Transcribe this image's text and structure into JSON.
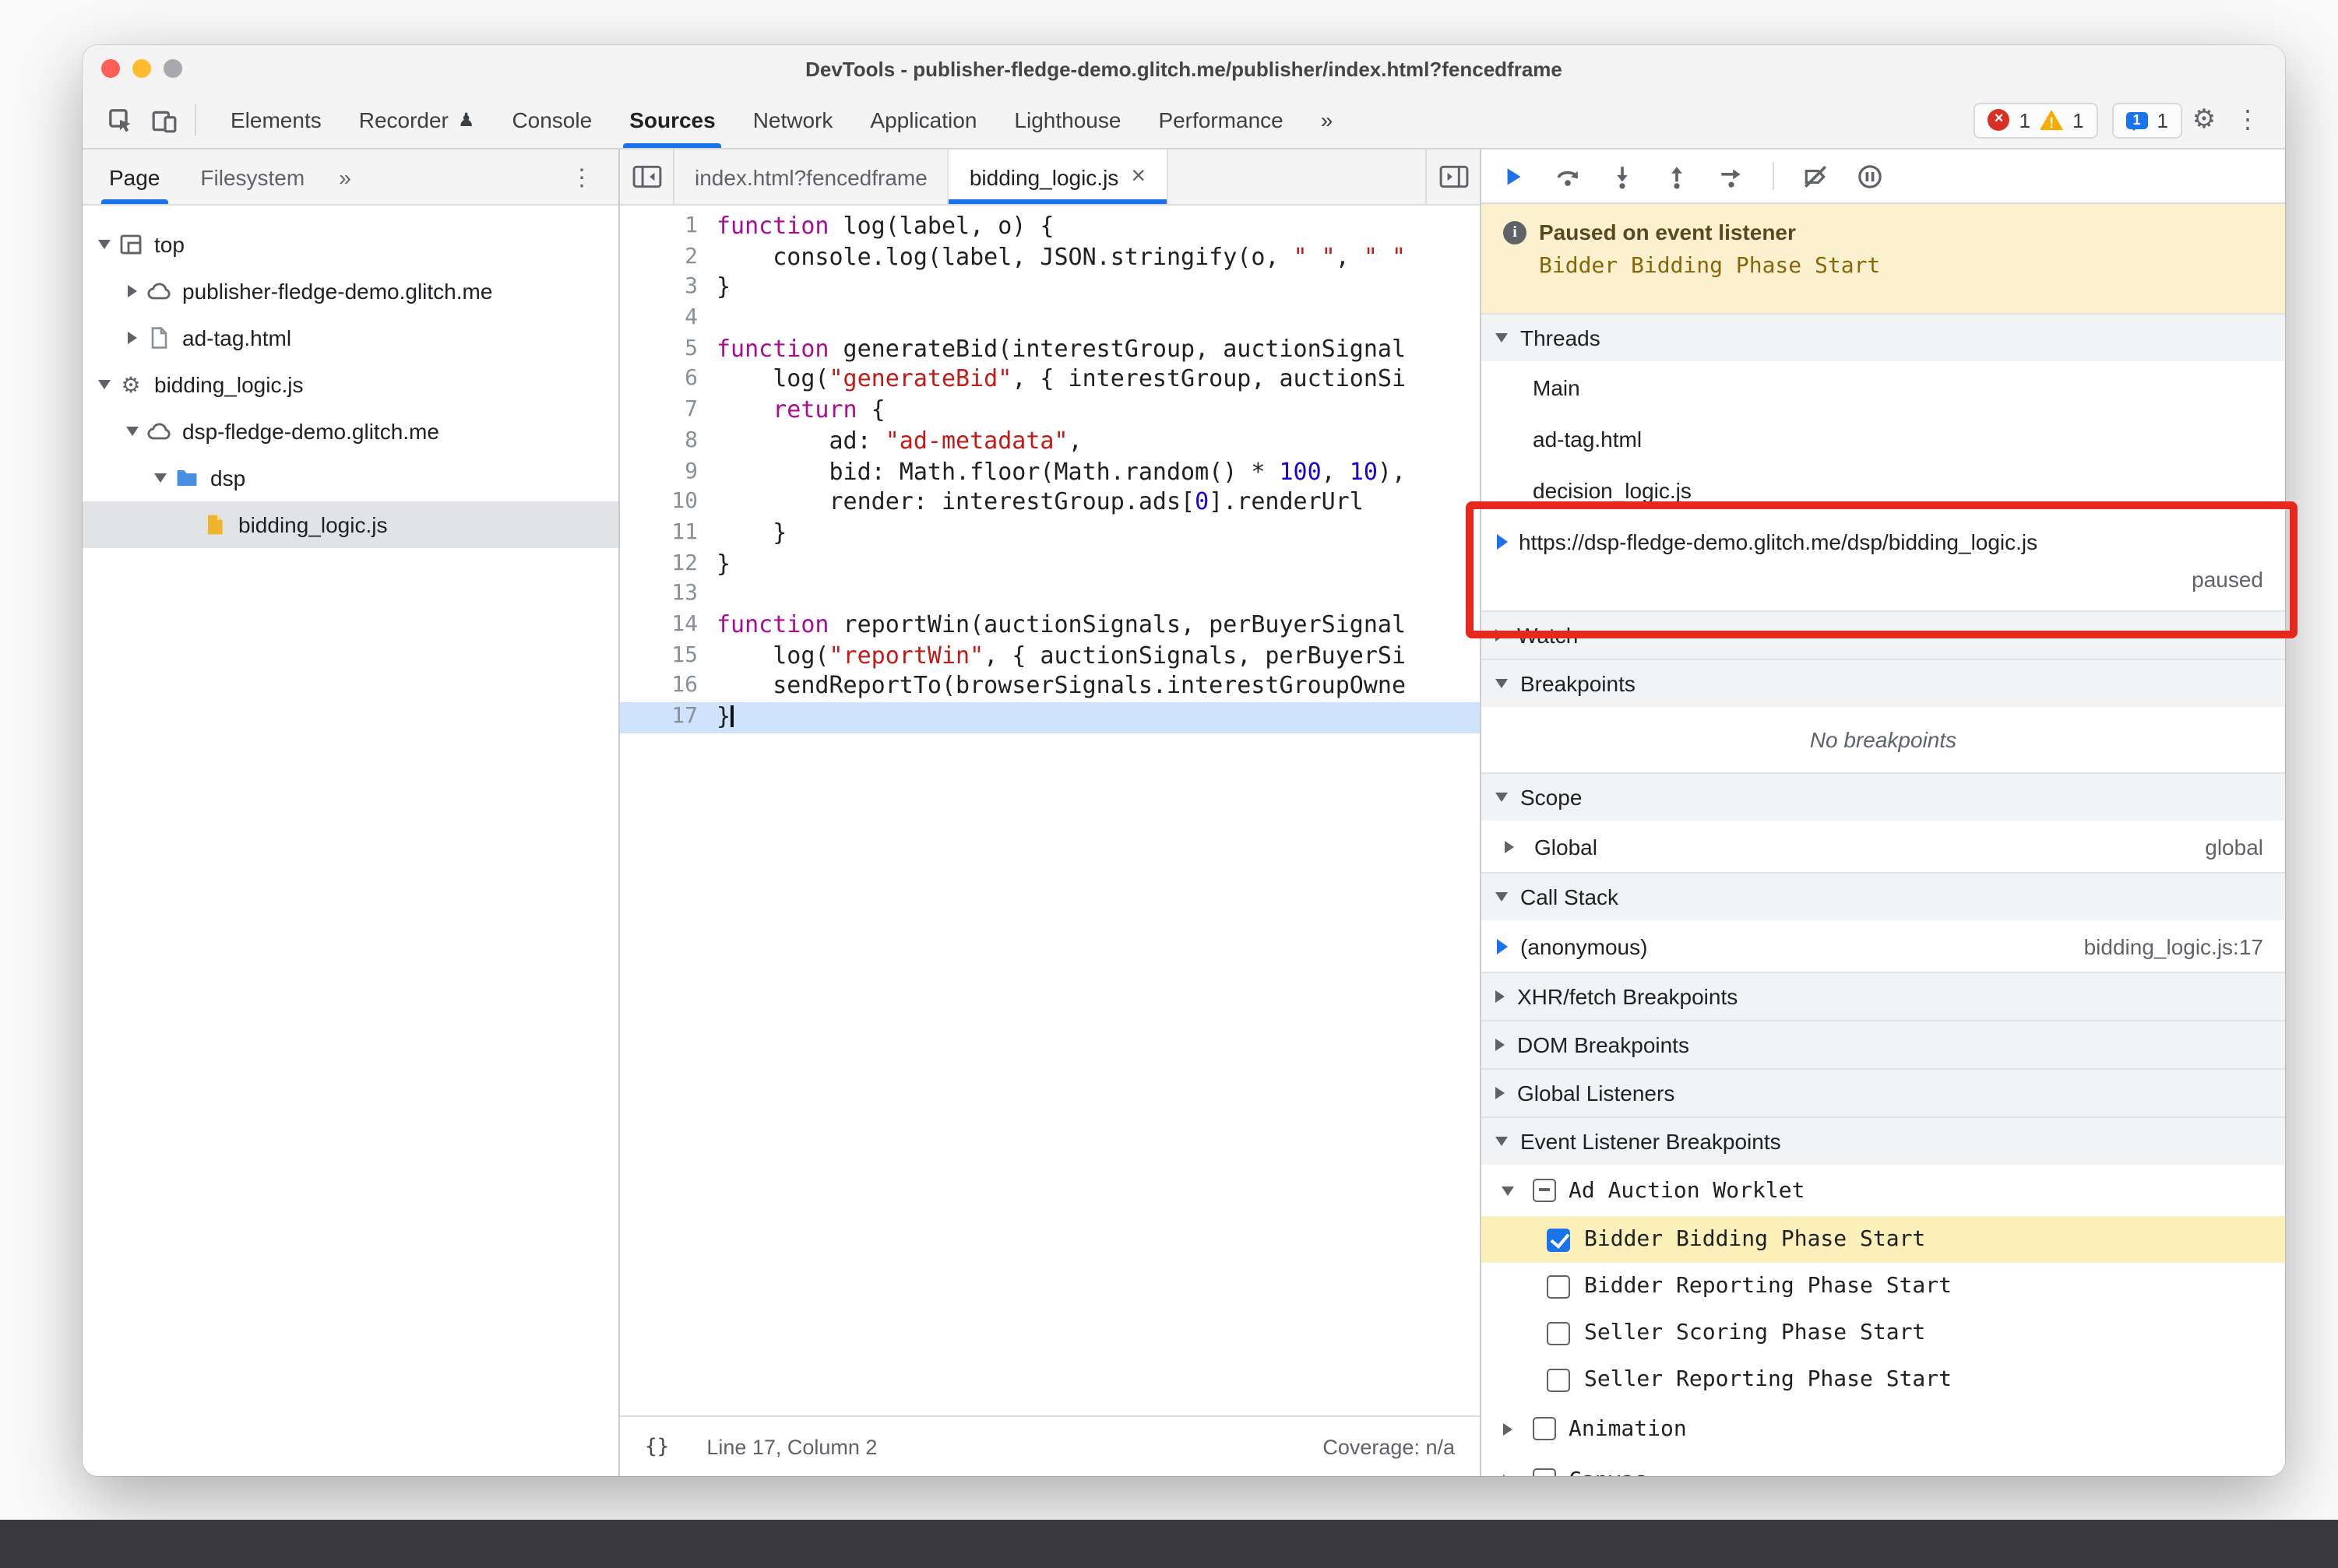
{
  "window": {
    "title": "DevTools - publisher-fledge-demo.glitch.me/publisher/index.html?fencedframe"
  },
  "colors": {
    "accent": "#1a73e8",
    "paused_banner": "#fbf1cf",
    "error": "#d93025",
    "warning": "#f9ab00",
    "annotation": "#e8271e"
  },
  "toolbar": {
    "tabs": [
      "Elements",
      "Recorder",
      "Console",
      "Sources",
      "Network",
      "Application",
      "Lighthouse",
      "Performance"
    ],
    "selected_tab": "Sources",
    "more_tabs": "»",
    "errors": "1",
    "warnings": "1",
    "issues": "1"
  },
  "sidebar": {
    "tabs": [
      "Page",
      "Filesystem"
    ],
    "more": "»",
    "tree": [
      {
        "label": "top"
      },
      {
        "label": "publisher-fledge-demo.glitch.me"
      },
      {
        "label": "ad-tag.html"
      },
      {
        "label": "bidding_logic.js"
      },
      {
        "label": "dsp-fledge-demo.glitch.me"
      },
      {
        "label": "dsp"
      },
      {
        "label": "bidding_logic.js"
      }
    ]
  },
  "editor": {
    "tabs": [
      {
        "label": "index.html?fencedframe"
      },
      {
        "label": "bidding_logic.js",
        "close": "×"
      }
    ],
    "lines": [
      {
        "n": "1",
        "s": [
          {
            "c": "k",
            "t": "function"
          },
          {
            "c": "p",
            "t": " log(label, o) {"
          }
        ]
      },
      {
        "n": "2",
        "s": [
          {
            "c": "p",
            "t": "    console.log(label, JSON.stringify(o, "
          },
          {
            "c": "s",
            "t": "\" \""
          },
          {
            "c": "p",
            "t": ", "
          },
          {
            "c": "s",
            "t": "\" \""
          }
        ]
      },
      {
        "n": "3",
        "s": [
          {
            "c": "p",
            "t": "}"
          }
        ]
      },
      {
        "n": "4",
        "s": []
      },
      {
        "n": "5",
        "s": [
          {
            "c": "k",
            "t": "function"
          },
          {
            "c": "p",
            "t": " generateBid(interestGroup, auctionSignal"
          }
        ]
      },
      {
        "n": "6",
        "s": [
          {
            "c": "p",
            "t": "    log("
          },
          {
            "c": "s",
            "t": "\"generateBid\""
          },
          {
            "c": "p",
            "t": ", { interestGroup, auctionSi"
          }
        ]
      },
      {
        "n": "7",
        "s": [
          {
            "c": "p",
            "t": "    "
          },
          {
            "c": "k",
            "t": "return"
          },
          {
            "c": "p",
            "t": " {"
          }
        ]
      },
      {
        "n": "8",
        "s": [
          {
            "c": "p",
            "t": "        ad: "
          },
          {
            "c": "s",
            "t": "\"ad-metadata\""
          },
          {
            "c": "p",
            "t": ","
          }
        ]
      },
      {
        "n": "9",
        "s": [
          {
            "c": "p",
            "t": "        bid: Math.floor(Math.random() * "
          },
          {
            "c": "n",
            "t": "100"
          },
          {
            "c": "p",
            "t": ", "
          },
          {
            "c": "n",
            "t": "10"
          },
          {
            "c": "p",
            "t": "),"
          }
        ]
      },
      {
        "n": "10",
        "s": [
          {
            "c": "p",
            "t": "        render: interestGroup.ads["
          },
          {
            "c": "n",
            "t": "0"
          },
          {
            "c": "p",
            "t": "].renderUrl"
          }
        ]
      },
      {
        "n": "11",
        "s": [
          {
            "c": "p",
            "t": "    }"
          }
        ]
      },
      {
        "n": "12",
        "s": [
          {
            "c": "p",
            "t": "}"
          }
        ]
      },
      {
        "n": "13",
        "s": []
      },
      {
        "n": "14",
        "s": [
          {
            "c": "k",
            "t": "function"
          },
          {
            "c": "p",
            "t": " reportWin(auctionSignals, perBuyerSignal"
          }
        ]
      },
      {
        "n": "15",
        "s": [
          {
            "c": "p",
            "t": "    log("
          },
          {
            "c": "s",
            "t": "\"reportWin\""
          },
          {
            "c": "p",
            "t": ", { auctionSignals, perBuyerSi"
          }
        ]
      },
      {
        "n": "16",
        "s": [
          {
            "c": "p",
            "t": "    sendReportTo(browserSignals.interestGroupOwne"
          }
        ]
      },
      {
        "n": "17",
        "s": [
          {
            "c": "p",
            "t": "}"
          }
        ],
        "current": true,
        "caret": true
      }
    ],
    "status": {
      "braces": "{}",
      "position": "Line 17, Column 2",
      "coverage": "Coverage: n/a"
    }
  },
  "debugger": {
    "paused": {
      "title": "Paused on event listener",
      "event": "Bidder Bidding Phase Start"
    },
    "threads": {
      "title": "Threads",
      "items": [
        "Main",
        "ad-tag.html",
        "decision_logic.js"
      ],
      "active": {
        "url": "https://dsp-fledge-demo.glitch.me/dsp/bidding_logic.js",
        "status": "paused"
      }
    },
    "watch": {
      "title": "Watch"
    },
    "breakpoints": {
      "title": "Breakpoints",
      "empty": "No breakpoints"
    },
    "scope": {
      "title": "Scope",
      "rows": [
        {
          "name": "Global",
          "value": "global"
        }
      ]
    },
    "call_stack": {
      "title": "Call Stack",
      "frames": [
        {
          "name": "(anonymous)",
          "location": "bidding_logic.js:17"
        }
      ]
    },
    "xhr_breakpoints": {
      "title": "XHR/fetch Breakpoints"
    },
    "dom_breakpoints": {
      "title": "DOM Breakpoints"
    },
    "global_listeners": {
      "title": "Global Listeners"
    },
    "event_listener_breakpoints": {
      "title": "Event Listener Breakpoints",
      "groups": [
        {
          "label": "Ad Auction Worklet",
          "checkbox": "indeterminate",
          "expanded": true,
          "children": [
            {
              "label": "Bidder Bidding Phase Start",
              "checked": true,
              "highlighted": true
            },
            {
              "label": "Bidder Reporting Phase Start",
              "checked": false
            },
            {
              "label": "Seller Scoring Phase Start",
              "checked": false
            },
            {
              "label": "Seller Reporting Phase Start",
              "checked": false
            }
          ]
        },
        {
          "label": "Animation",
          "checkbox": "unchecked",
          "expanded": false
        },
        {
          "label": "Canvas",
          "checkbox": "unchecked",
          "expanded": false
        }
      ]
    }
  }
}
